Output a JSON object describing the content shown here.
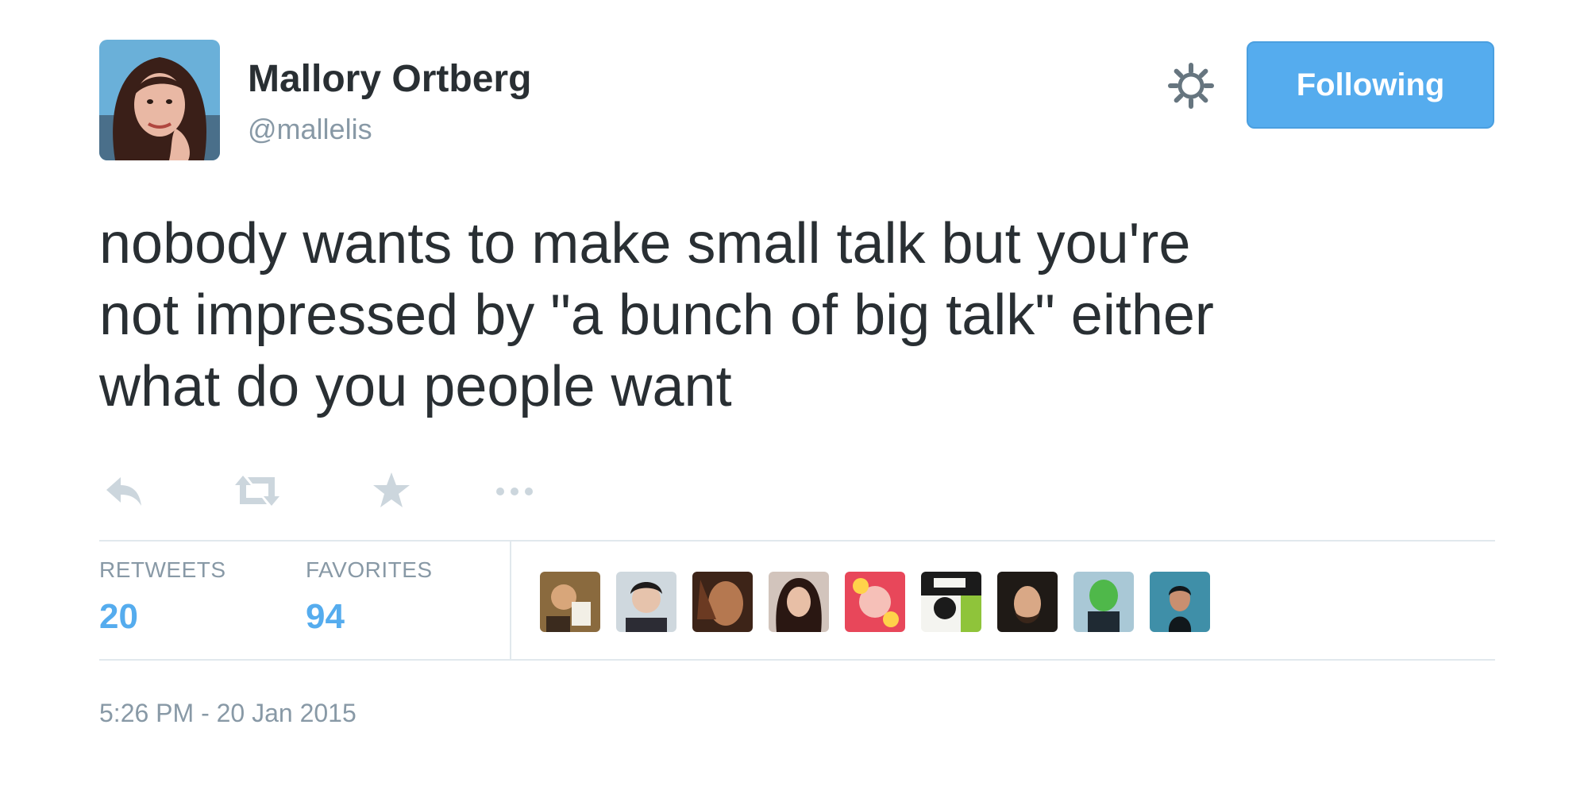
{
  "author": {
    "display_name": "Mallory Ortberg",
    "handle": "@mallelis"
  },
  "header": {
    "follow_label": "Following",
    "settings_icon": "gear-icon"
  },
  "tweet": {
    "text": "nobody wants to make small talk but you're\nnot impressed by \"a bunch of big talk\" either\nwhat do you people want"
  },
  "actions": [
    {
      "name": "reply-icon"
    },
    {
      "name": "retweet-icon"
    },
    {
      "name": "favorite-icon"
    },
    {
      "name": "more-icon"
    }
  ],
  "stats": {
    "retweets_label": "RETWEETS",
    "retweets_count": "20",
    "favorites_label": "FAVORITES",
    "favorites_count": "94"
  },
  "favoriters_count_shown": 9,
  "timestamp": "5:26 PM - 20 Jan 2015",
  "colors": {
    "accent": "#55acee",
    "text": "#292f33",
    "muted": "#8899a6",
    "divider": "#e1e8ed"
  }
}
